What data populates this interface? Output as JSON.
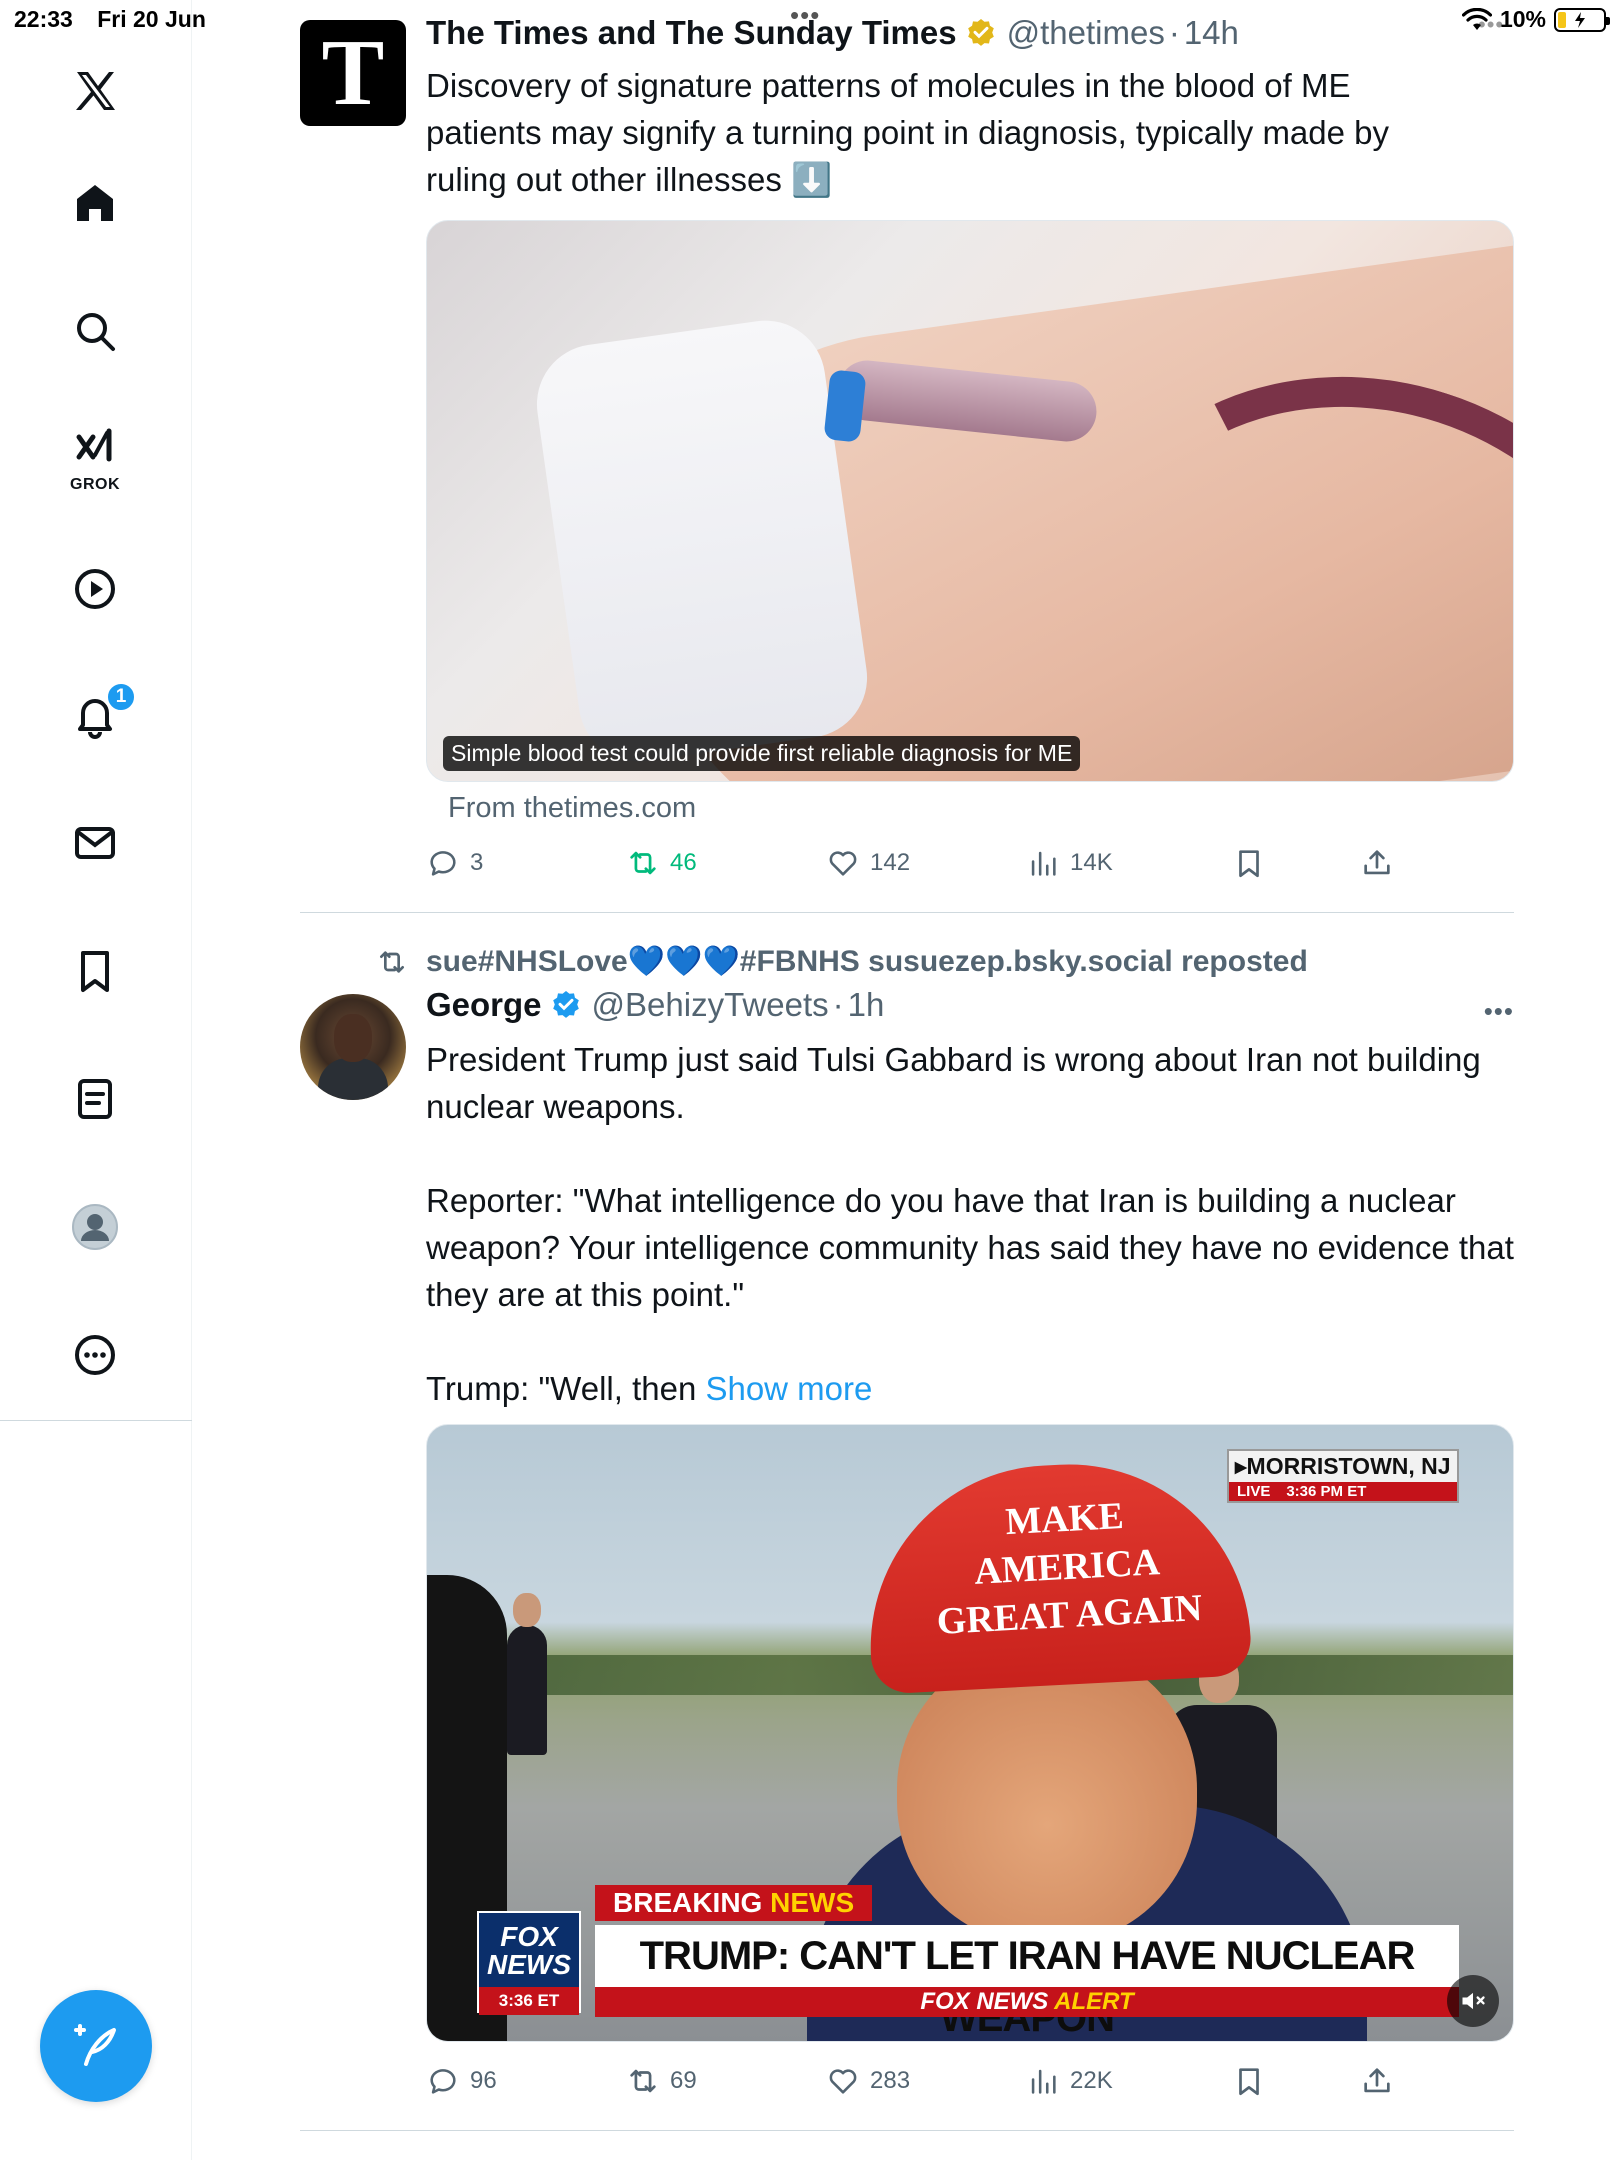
{
  "status_bar": {
    "time": "22:33",
    "date": "Fri 20 Jun",
    "battery_pct": "10%",
    "top_dots": "•••",
    "right_dots": "•••"
  },
  "sidebar": {
    "items": [
      {
        "name": "home",
        "icon": "home-icon"
      },
      {
        "name": "explore",
        "icon": "search-icon"
      },
      {
        "name": "grok",
        "icon": "grok-icon",
        "label": "GROK"
      },
      {
        "name": "video",
        "icon": "play-icon"
      },
      {
        "name": "notifications",
        "icon": "bell-icon",
        "badge": "1"
      },
      {
        "name": "messages",
        "icon": "mail-icon"
      },
      {
        "name": "bookmarks",
        "icon": "bookmark-icon"
      },
      {
        "name": "lists",
        "icon": "list-icon"
      },
      {
        "name": "profile",
        "icon": "avatar-icon"
      },
      {
        "name": "more",
        "icon": "more-icon"
      }
    ],
    "compose_icon": "compose-icon"
  },
  "tweets": [
    {
      "author_name": "The Times and The Sunday Times",
      "handle": "@thetimes",
      "sep": "·",
      "age": "14h",
      "avatar_letter": "T",
      "verified_color": "#e2b719",
      "text": "Discovery of signature patterns of molecules in the blood of ME patients may signify a turning point in diagnosis, typically made by ruling out other illnesses ⬇️",
      "card_caption": "Simple blood test could provide first reliable diagnosis for ME",
      "card_source": "From thetimes.com",
      "stats": {
        "replies": "3",
        "reposts": "46",
        "likes": "142",
        "views": "14K"
      },
      "reposted_by_viewer": true
    },
    {
      "repost_by": "sue#NHSLove💙💙💙#FBNHS susuezep.bsky.social reposted",
      "author_name": "George",
      "handle": "@BehizyTweets",
      "sep": "·",
      "age": "1h",
      "verified_color": "#1d9bf0",
      "more": "•••",
      "text": "President Trump just said Tulsi Gabbard is wrong about Iran not building nuclear weapons.\n\nReporter: \"What intelligence do you have that Iran is building a nuclear weapon? Your intelligence community has said they have no evidence that they are at this point.\"\n\nTrump: \"Well, then ",
      "show_more": "Show more",
      "video": {
        "cap_text": "MAKE AMERICA GREAT AGAIN",
        "location": "▸MORRISTOWN, NJ",
        "live": "LIVE",
        "live_time": "3:36 PM ET",
        "breaking": "BREAKING",
        "news": "NEWS",
        "headline": "TRUMP: CAN'T LET IRAN HAVE NUCLEAR WEAPON",
        "alert_1": "FOX NEWS",
        "alert_2": "ALERT",
        "logo_1": "FOX",
        "logo_2": "NEWS",
        "logo_time": "3:36 ET"
      },
      "stats": {
        "replies": "96",
        "reposts": "69",
        "likes": "283",
        "views": "22K"
      }
    }
  ]
}
